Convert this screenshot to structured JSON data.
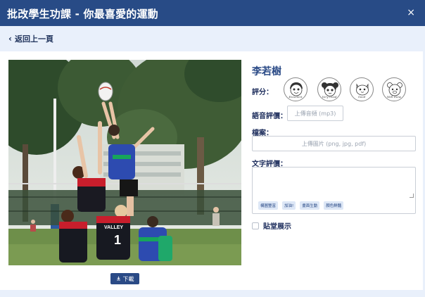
{
  "dialog": {
    "title": "批改學生功課 - 你最喜愛的運動",
    "close_glyph": "×"
  },
  "nav": {
    "back_label": "返回上一頁"
  },
  "photo": {
    "jersey_text": "VALLEY",
    "jersey_number": "1"
  },
  "download": {
    "label": "下載"
  },
  "student": {
    "name": "李若樹"
  },
  "rating": {
    "label": "評分：",
    "stickers": [
      {
        "icon": "boy-face-sticker-icon",
        "caption": "Excellent"
      },
      {
        "icon": "girl-face-sticker-icon",
        "caption": "Very Good"
      },
      {
        "icon": "cat-face-sticker-icon",
        "caption": "Good"
      },
      {
        "icon": "bear-face-sticker-icon",
        "caption": "Well Done"
      }
    ]
  },
  "voice": {
    "label": "語音評價：",
    "upload_label": "上傳音頻 (mp3)"
  },
  "file": {
    "label": "檔案：",
    "upload_label": "上傳圖片 (png, jpg, pdf)"
  },
  "text_review": {
    "label": "文字評價：",
    "tags": [
      "構圖豐富",
      "加油!",
      "畫面生動",
      "顏色鮮豔"
    ]
  },
  "showcase": {
    "label": "貼堂展示"
  },
  "colors": {
    "header": "#284b86",
    "subbar": "#e9f0fb",
    "accent": "#2a4a86"
  }
}
